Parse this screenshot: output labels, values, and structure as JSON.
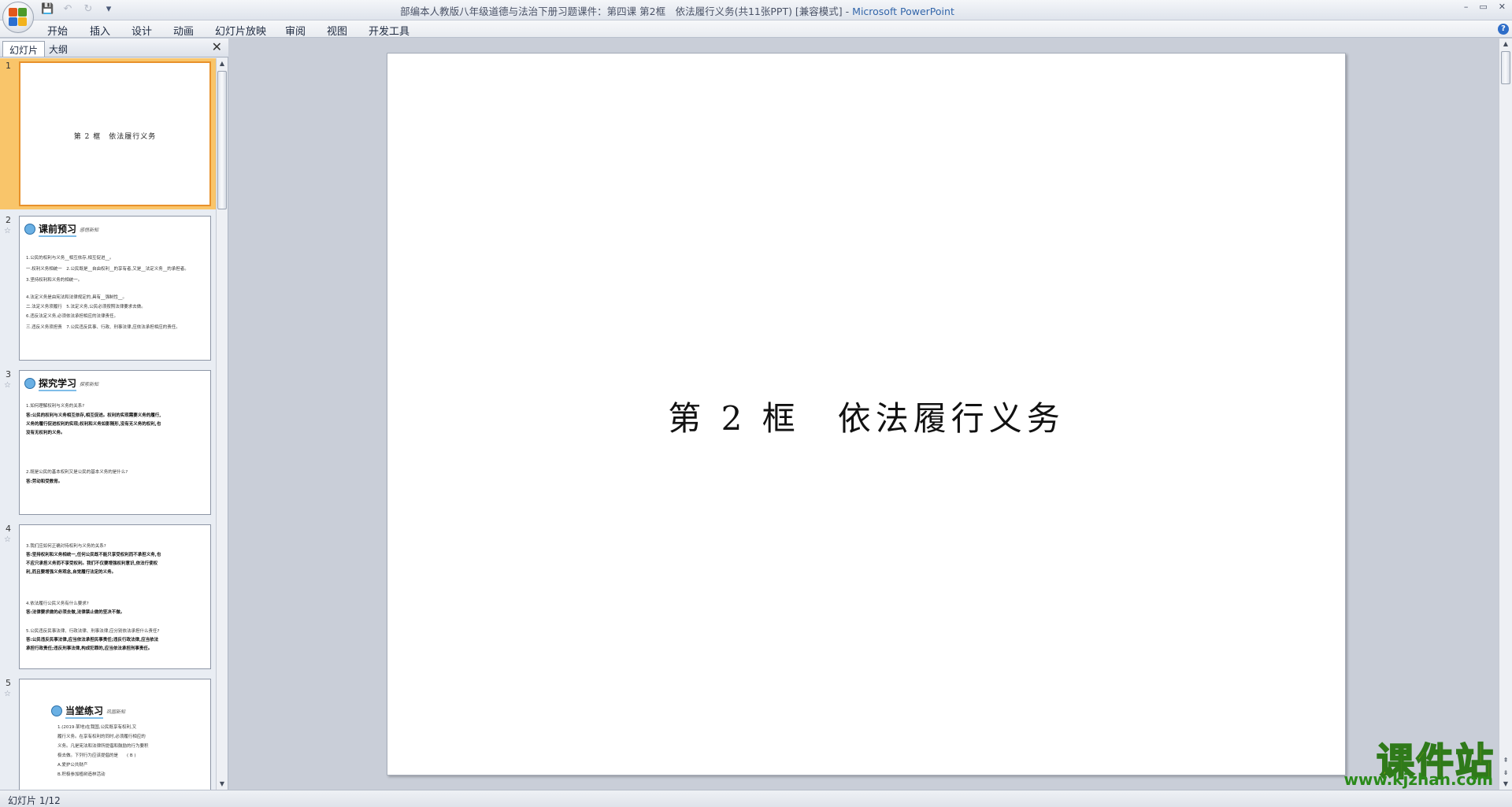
{
  "window": {
    "title": "部编本人教版八年级道德与法治下册习题课件：第四课 第2框　依法履行义务(共11张PPT) [兼容模式]",
    "app_name": "Microsoft PowerPoint",
    "controls": {
      "minimize": "–",
      "restore": "▭",
      "close": "✕"
    }
  },
  "qat": {
    "save_icon": "💾",
    "undo_icon": "↶",
    "redo_icon": "↻",
    "customize_icon": "▾"
  },
  "ribbon": {
    "tabs": [
      "开始",
      "插入",
      "设计",
      "动画",
      "幻灯片放映",
      "审阅",
      "视图",
      "开发工具"
    ],
    "help": "?"
  },
  "panel": {
    "tabs": [
      "幻灯片",
      "大纲"
    ],
    "close": "✕"
  },
  "thumbnails": [
    {
      "number": "1",
      "title": "第 2 框　依法履行义务"
    },
    {
      "number": "2",
      "banner": "课前预习",
      "banner_sub": "感悟新知",
      "lines": [
        "1.公民的权利与义务__相互依存,相互促进__。",
        "一.权利义务相统一　2.公民既是__自由权利__的享有者,又是__法定义务__的承担者。",
        "3.坚持权利和义务的相统一。",
        "4.法定义务是由宪法和法律规定的,具有__强制性__。",
        "二.法定义务须履行　5.法定义务,公民必须按照法律要求去做。",
        "6.违反法定义务,必须依法承担相应的法律责任。",
        "三.违反义务须担责　7.公民违反民事、行政、刑事法律,应依法承担相应的责任。"
      ]
    },
    {
      "number": "3",
      "banner": "探究学习",
      "banner_sub": "探索新知",
      "lines": [
        "1.如何理解权利与义务的关系?",
        "答:公民的权利与义务相互依存,相互促进。权利的实现需要义务的履行,",
        "义务的履行促进权利的实现;权利和义务如影随形,没有无义务的权利,也",
        "没有无权利的义务。",
        "2.既是公民的基本权利又是公民的基本义务的是什么?",
        "答:劳动和受教育。"
      ]
    },
    {
      "number": "4",
      "lines": [
        "3.我们应如何正确对待权利与义务的关系?",
        "答:坚持权利和义务相统一,任何公民既不能只享受权利而不承担义务,也",
        "不应只承担义务而不享受权利。我们不仅要增强权利意识,依法行使权",
        "利,而且要增强义务观念,自觉履行法定的义务。",
        "4.依法履行公民义务有什么要求?",
        "答:法律要求做的必须去做,法律禁止做的坚决不做。",
        "5.公民违反民事法律、行政法律、刑事法律,应分别依法承担什么责任?",
        "答:公民违反民事法律,应当依法承担民事责任;违反行政法律,应当依法",
        "承担行政责任;违反刑事法律,构成犯罪的,应当依法承担刑事责任。"
      ]
    },
    {
      "number": "5",
      "banner": "当堂练习",
      "banner_sub": "巩固新知",
      "lines": [
        "1.(2019·某地)在我国,公民既享有权利,又",
        "履行义务。在享有权利的同时,必须履行相应的",
        "义务。凡是宪法和法律所提倡和鼓励的行为要积",
        "极去做。下列行为应该提倡的是　　( B )",
        "A.爱护公共财产",
        "B.积极参加植树造林活动"
      ]
    }
  ],
  "slide": {
    "title": "第 2 框　依法履行义务"
  },
  "status": {
    "slide_counter": "幻灯片 1/12"
  },
  "watermark": {
    "text": "课件站",
    "url": "www.kjzhan.com"
  }
}
